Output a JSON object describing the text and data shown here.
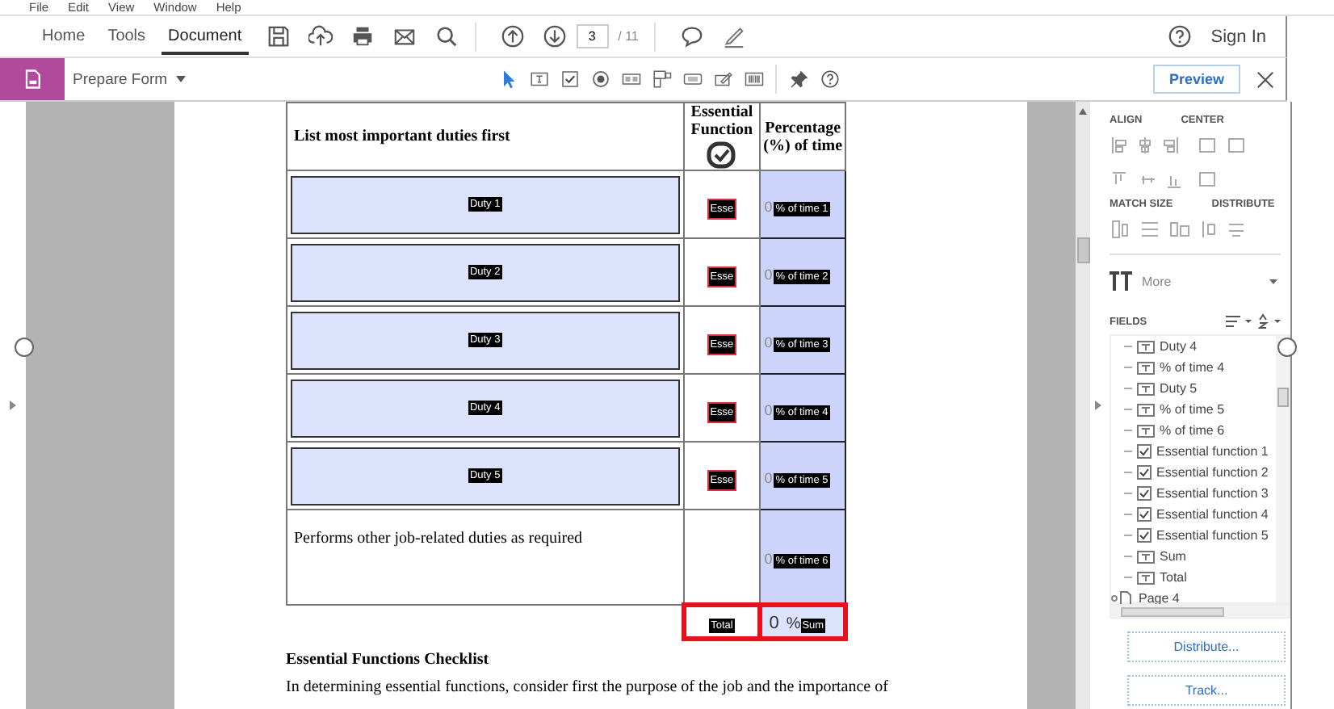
{
  "menu": [
    "File",
    "Edit",
    "View",
    "Window",
    "Help"
  ],
  "tabs": [
    {
      "label": "Home",
      "selected": false
    },
    {
      "label": "Tools",
      "selected": false
    },
    {
      "label": "Document",
      "selected": true
    }
  ],
  "page_nav": {
    "current": "3",
    "total": "/ 11"
  },
  "sign_in": "Sign In",
  "tool_name": "Prepare Form",
  "preview": "Preview",
  "table": {
    "columns": [
      "List most important duties first",
      "Essential Function",
      "Percentage (%) of time"
    ],
    "rows": [
      {
        "kind": "field",
        "duty": "Duty 1",
        "check": "Esse",
        "placeholder": "0",
        "percent": "% of time 1"
      },
      {
        "kind": "field",
        "duty": "Duty 2",
        "check": "Esse",
        "placeholder": "0",
        "percent": "% of time 2"
      },
      {
        "kind": "field",
        "duty": "Duty 3",
        "check": "Esse",
        "placeholder": "0",
        "percent": "% of time 3"
      },
      {
        "kind": "field",
        "duty": "Duty 4",
        "check": "Esse",
        "placeholder": "0",
        "percent": "% of time 4"
      },
      {
        "kind": "field",
        "duty": "Duty 5",
        "check": "Esse",
        "placeholder": "0",
        "percent": "% of time 5"
      },
      {
        "kind": "text",
        "duty": "Performs other job-related duties as required",
        "placeholder": "0",
        "percent": "% of time 6"
      }
    ],
    "total": {
      "label": "Total",
      "value": "0",
      "unit": "%",
      "field": "Sum"
    }
  },
  "section_title": "Essential Functions Checklist",
  "paragraph": "In determining essential functions, consider first the purpose of the job and the importance of",
  "panel": {
    "align": "ALIGN",
    "center": "CENTER",
    "match_size": "MATCH SIZE",
    "distribute": "DISTRIBUTE",
    "more": "More",
    "fields_title": "FIELDS",
    "fields": [
      {
        "kind": "text",
        "label": "Duty 4"
      },
      {
        "kind": "text",
        "label": "% of time 4"
      },
      {
        "kind": "text",
        "label": "Duty 5"
      },
      {
        "kind": "text",
        "label": "% of time 5"
      },
      {
        "kind": "text",
        "label": "% of time 6"
      },
      {
        "kind": "checkbox",
        "label": "Essential function 1"
      },
      {
        "kind": "checkbox",
        "label": "Essential function 2"
      },
      {
        "kind": "checkbox",
        "label": "Essential function 3"
      },
      {
        "kind": "checkbox",
        "label": "Essential function 4"
      },
      {
        "kind": "checkbox",
        "label": "Essential function 5"
      },
      {
        "kind": "text",
        "label": "Sum"
      },
      {
        "kind": "text",
        "label": "Total"
      }
    ],
    "page_node": "Page 4",
    "buttons": [
      "Distribute...",
      "Track..."
    ]
  }
}
